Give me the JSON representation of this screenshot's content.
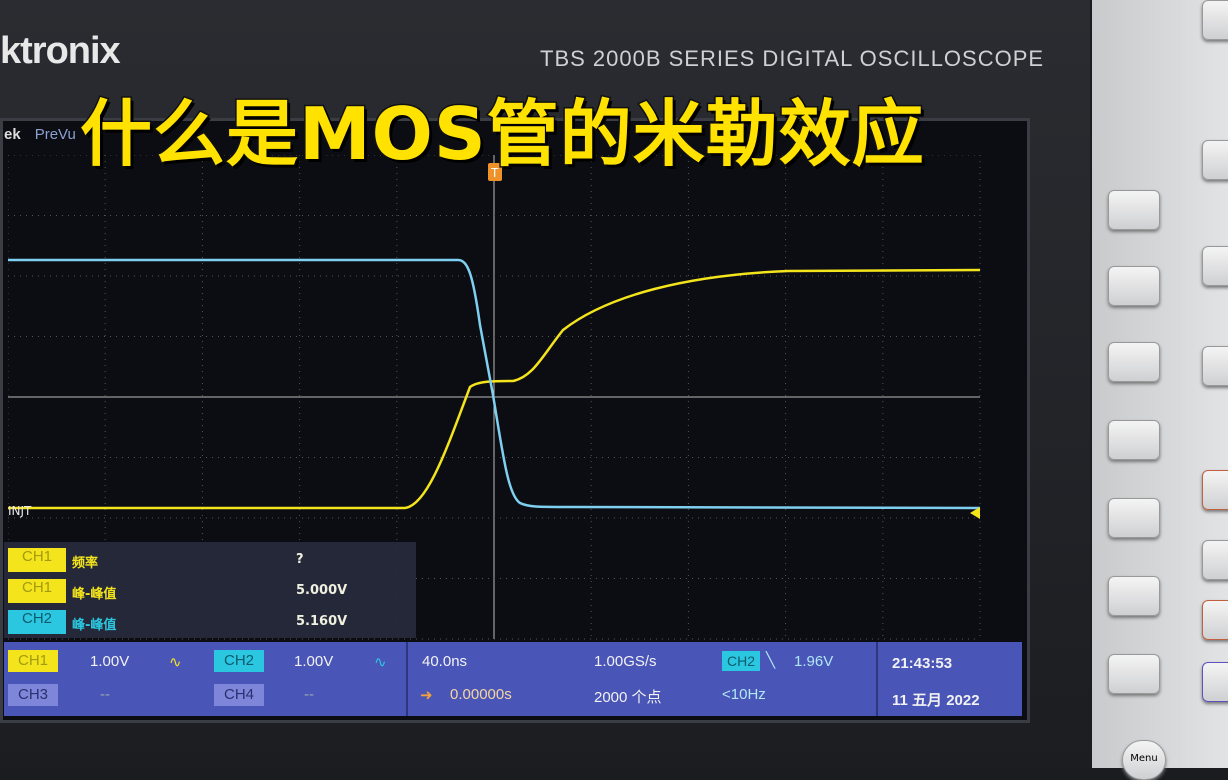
{
  "overlay_title": "什么是MOS管的米勒效应",
  "device": {
    "logo": "ktronix",
    "series": "TBS 2000B SERIES  DIGITAL OSCILLOSCOPE",
    "brand_short": "ek",
    "mode": "PreVu",
    "trigger_marker": "T",
    "ground_label": "INJT",
    "menu_button": "Menu"
  },
  "colors": {
    "ch1": "#f3e41c",
    "ch2": "#2bc7e0",
    "status_bar": "#4a55b8"
  },
  "measurements": [
    {
      "channel": "CH1",
      "label": "频率",
      "value": "?"
    },
    {
      "channel": "CH1",
      "label": "峰-峰值",
      "value": "5.000V"
    },
    {
      "channel": "CH2",
      "label": "峰-峰值",
      "value": "5.160V"
    }
  ],
  "status": {
    "ch1": {
      "label": "CH1",
      "scale": "1.00V"
    },
    "ch2": {
      "label": "CH2",
      "scale": "1.00V"
    },
    "ch3": {
      "label": "CH3",
      "scale": "--"
    },
    "ch4": {
      "label": "CH4",
      "scale": "--"
    },
    "timebase": "40.0ns",
    "position": "0.00000s",
    "sample_rate": "1.00GS/s",
    "record_length": "2000 个点",
    "trigger_source": "CH2",
    "trigger_slope": "╲",
    "trigger_level": "1.96V",
    "trigger_freq": "<10Hz",
    "time": "21:43:53",
    "date": "11 五月 2022"
  }
}
